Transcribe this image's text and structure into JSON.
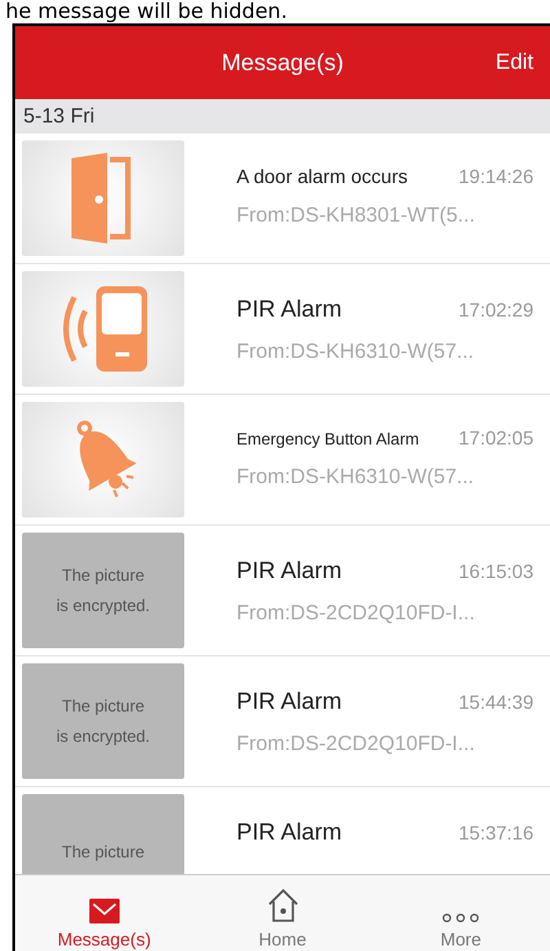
{
  "caption": "he message will be hidden.",
  "header": {
    "title": "Message(s)",
    "action": "Edit"
  },
  "date_group": "5-13 Fri",
  "messages": [
    {
      "thumbnail": {
        "kind": "door"
      },
      "title": "A door alarm occurs",
      "time": "19:14:26",
      "source": "From:DS-KH8301-WT(5..."
    },
    {
      "thumbnail": {
        "kind": "pir"
      },
      "title": "PIR Alarm",
      "time": "17:02:29",
      "source": "From:DS-KH6310-W(57..."
    },
    {
      "thumbnail": {
        "kind": "bell"
      },
      "title": "Emergency Button Alarm",
      "time": "17:02:05",
      "source": "From:DS-KH6310-W(57..."
    },
    {
      "thumbnail": {
        "kind": "encrypted",
        "lines": [
          "The picture",
          "is encrypted."
        ]
      },
      "title": "PIR Alarm",
      "time": "16:15:03",
      "source": "From:DS-2CD2Q10FD-I..."
    },
    {
      "thumbnail": {
        "kind": "encrypted",
        "lines": [
          "The picture",
          "is encrypted."
        ]
      },
      "title": "PIR Alarm",
      "time": "15:44:39",
      "source": "From:DS-2CD2Q10FD-I..."
    },
    {
      "thumbnail": {
        "kind": "encrypted",
        "lines": [
          "The picture"
        ]
      },
      "title": "PIR Alarm",
      "time": "15:37:16"
    }
  ],
  "tabs": [
    {
      "label": "Message(s)",
      "kind": "messages",
      "selected": true
    },
    {
      "label": "Home",
      "kind": "home",
      "selected": false
    },
    {
      "label": "More",
      "kind": "more",
      "selected": false
    }
  ]
}
